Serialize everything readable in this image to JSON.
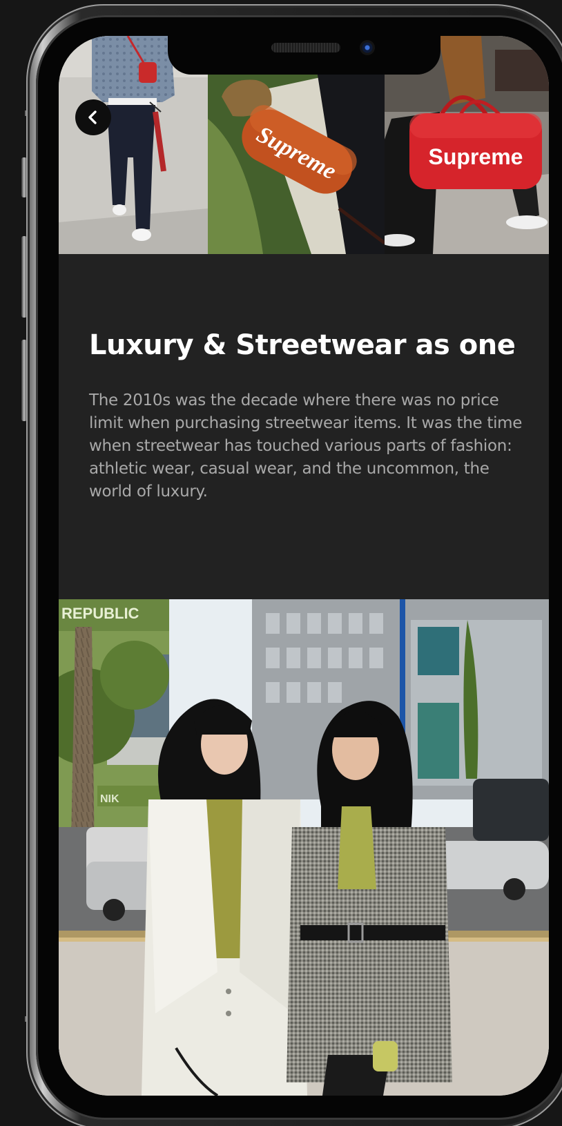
{
  "article": {
    "headline": "Luxury & Streetwear as one",
    "body": "The 2010s was the decade where there was no price limit when purchasing streetwear items. It was the time when streetwear has touched various parts of fashion: athletic wear, casual wear, and the uncommon, the world of luxury."
  },
  "hero": {
    "bag_brand_text": "Supreme",
    "duffel_brand_text": "Supreme"
  },
  "street_photo": {
    "sign_text_left": "REPUBLIC",
    "sign_text_lower": "NIK"
  },
  "navigation": {
    "back_icon": "chevron-left-icon"
  },
  "colors": {
    "background": "#161616",
    "screen_background": "#222222",
    "headline": "#ffffff",
    "body_text": "#a9a9a9",
    "accent_red": "#d6242b"
  }
}
